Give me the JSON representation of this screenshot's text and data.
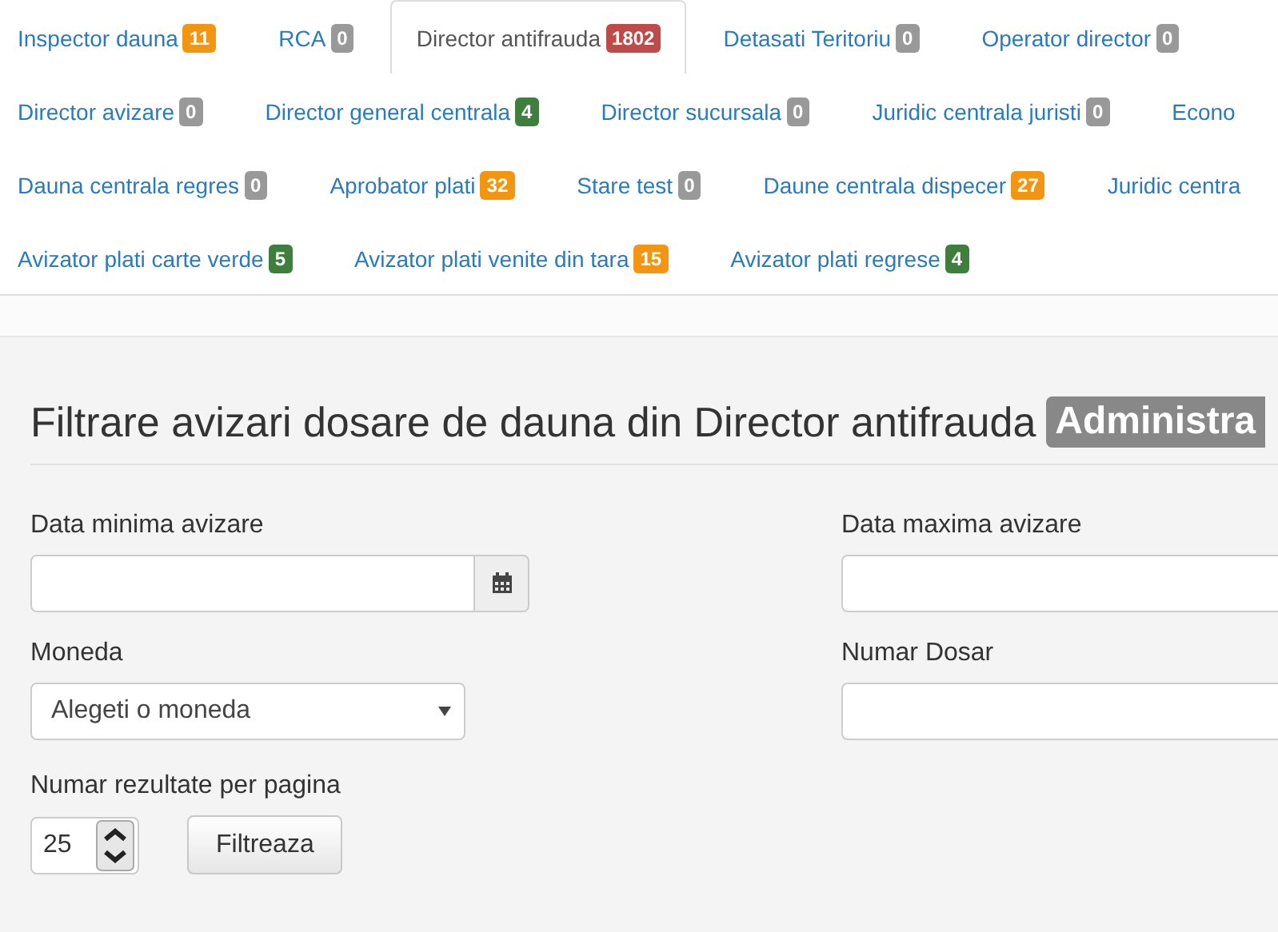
{
  "tab_rows": [
    [
      {
        "label": "Inspector dauna",
        "badge": "11",
        "color": "#f39510",
        "selected": false
      },
      {
        "label": "RCA",
        "badge": "0",
        "color": "#999999",
        "selected": false
      },
      {
        "label": "Director antifrauda",
        "badge": "1802",
        "color": "#bf4a4a",
        "selected": true
      },
      {
        "label": "Detasati Teritoriu",
        "badge": "0",
        "color": "#999999",
        "selected": false
      },
      {
        "label": "Operator director",
        "badge": "0",
        "color": "#999999",
        "selected": false
      }
    ],
    [
      {
        "label": "Director avizare",
        "badge": "0",
        "color": "#999999",
        "selected": false
      },
      {
        "label": "Director general centrala",
        "badge": "4",
        "color": "#3e7f3e",
        "selected": false
      },
      {
        "label": "Director sucursala",
        "badge": "0",
        "color": "#999999",
        "selected": false
      },
      {
        "label": "Juridic centrala juristi",
        "badge": "0",
        "color": "#999999",
        "selected": false
      },
      {
        "label": "Econo",
        "selected": false
      }
    ],
    [
      {
        "label": "Dauna centrala regres",
        "badge": "0",
        "color": "#999999",
        "selected": false
      },
      {
        "label": "Aprobator plati",
        "badge": "32",
        "color": "#f39510",
        "selected": false
      },
      {
        "label": "Stare test",
        "badge": "0",
        "color": "#999999",
        "selected": false
      },
      {
        "label": "Daune centrala dispecer",
        "badge": "27",
        "color": "#f39510",
        "selected": false
      },
      {
        "label": "Juridic centra",
        "selected": false
      }
    ],
    [
      {
        "label": "Avizator plati carte verde",
        "badge": "5",
        "color": "#3e7f3e",
        "selected": false
      },
      {
        "label": "Avizator plati venite din tara",
        "badge": "15",
        "color": "#f39510",
        "selected": false
      },
      {
        "label": "Avizator plati regrese",
        "badge": "4",
        "color": "#3e7f3e",
        "selected": false
      }
    ]
  ],
  "panel": {
    "title": "Filtrare avizari dosare de dauna din Director antifrauda",
    "title_label": "Administra",
    "field_rows": [
      [
        {
          "kind": "date",
          "label": "Data minima avizare"
        },
        {
          "kind": "text",
          "label": "Data maxima avizare"
        }
      ],
      [
        {
          "kind": "select",
          "label": "Moneda",
          "value": "Alegeti o moneda"
        },
        {
          "kind": "text",
          "label": "Numar Dosar"
        }
      ],
      [
        {
          "kind": "number",
          "label": "Numar rezultate per pagina",
          "value": "25"
        }
      ]
    ],
    "filter_button": "Filtreaza"
  }
}
